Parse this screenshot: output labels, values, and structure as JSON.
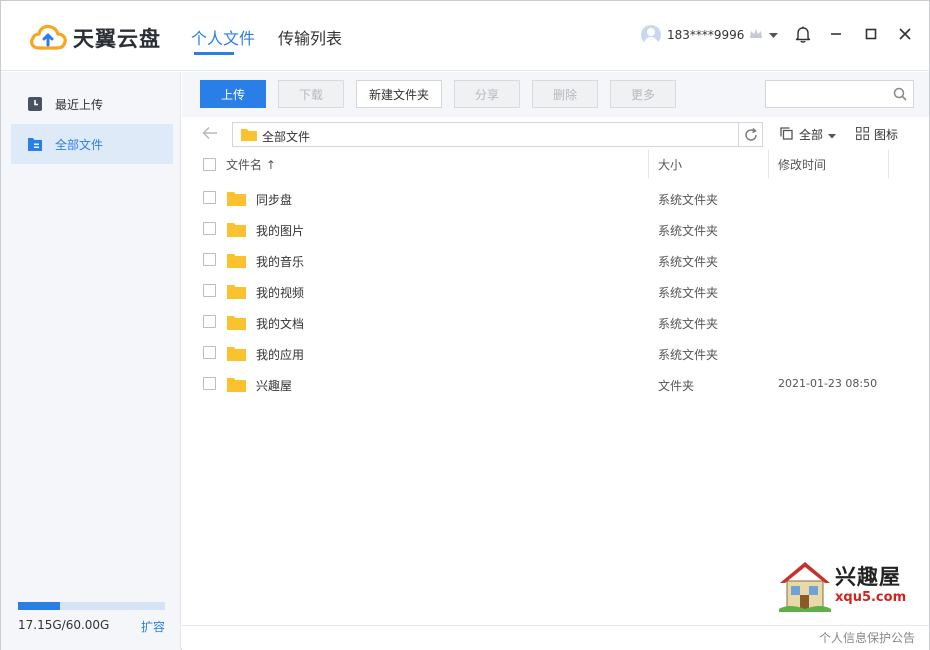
{
  "app": {
    "logo_text": "天翼云盘"
  },
  "nav": {
    "tabs": [
      {
        "label": "个人文件",
        "active": true
      },
      {
        "label": "传输列表",
        "active": false
      }
    ]
  },
  "user": {
    "phone": "183****9996"
  },
  "sidebar": {
    "items": [
      {
        "label": "最近上传",
        "icon": "clock-icon",
        "active": false
      },
      {
        "label": "全部文件",
        "icon": "files-icon",
        "active": true
      }
    ],
    "storage": {
      "text": "17.15G/60.00G",
      "used_fraction": 0.286,
      "expand_label": "扩容"
    }
  },
  "toolbar": {
    "upload": "上传",
    "download": "下载",
    "new_folder": "新建文件夹",
    "share": "分享",
    "delete": "删除",
    "more": "更多",
    "search_placeholder": ""
  },
  "path": {
    "current": "全部文件"
  },
  "view": {
    "filter_label": "全部",
    "icon_view_label": "图标"
  },
  "table": {
    "headers": {
      "name": "文件名 ↑",
      "size": "大小",
      "mtime": "修改时间"
    },
    "rows": [
      {
        "name": "同步盘",
        "type": "系统文件夹",
        "mtime": ""
      },
      {
        "name": "我的图片",
        "type": "系统文件夹",
        "mtime": ""
      },
      {
        "name": "我的音乐",
        "type": "系统文件夹",
        "mtime": ""
      },
      {
        "name": "我的视频",
        "type": "系统文件夹",
        "mtime": ""
      },
      {
        "name": "我的文档",
        "type": "系统文件夹",
        "mtime": ""
      },
      {
        "name": "我的应用",
        "type": "系统文件夹",
        "mtime": ""
      },
      {
        "name": "兴趣屋",
        "type": "文件夹",
        "mtime": "2021-01-23 08:50"
      }
    ]
  },
  "footer": {
    "privacy_notice": "个人信息保护公告"
  },
  "watermark": {
    "title": "兴趣屋",
    "url": "xqu5.com"
  },
  "colors": {
    "accent": "#2a7fe6",
    "folder": "#f9c22e"
  }
}
